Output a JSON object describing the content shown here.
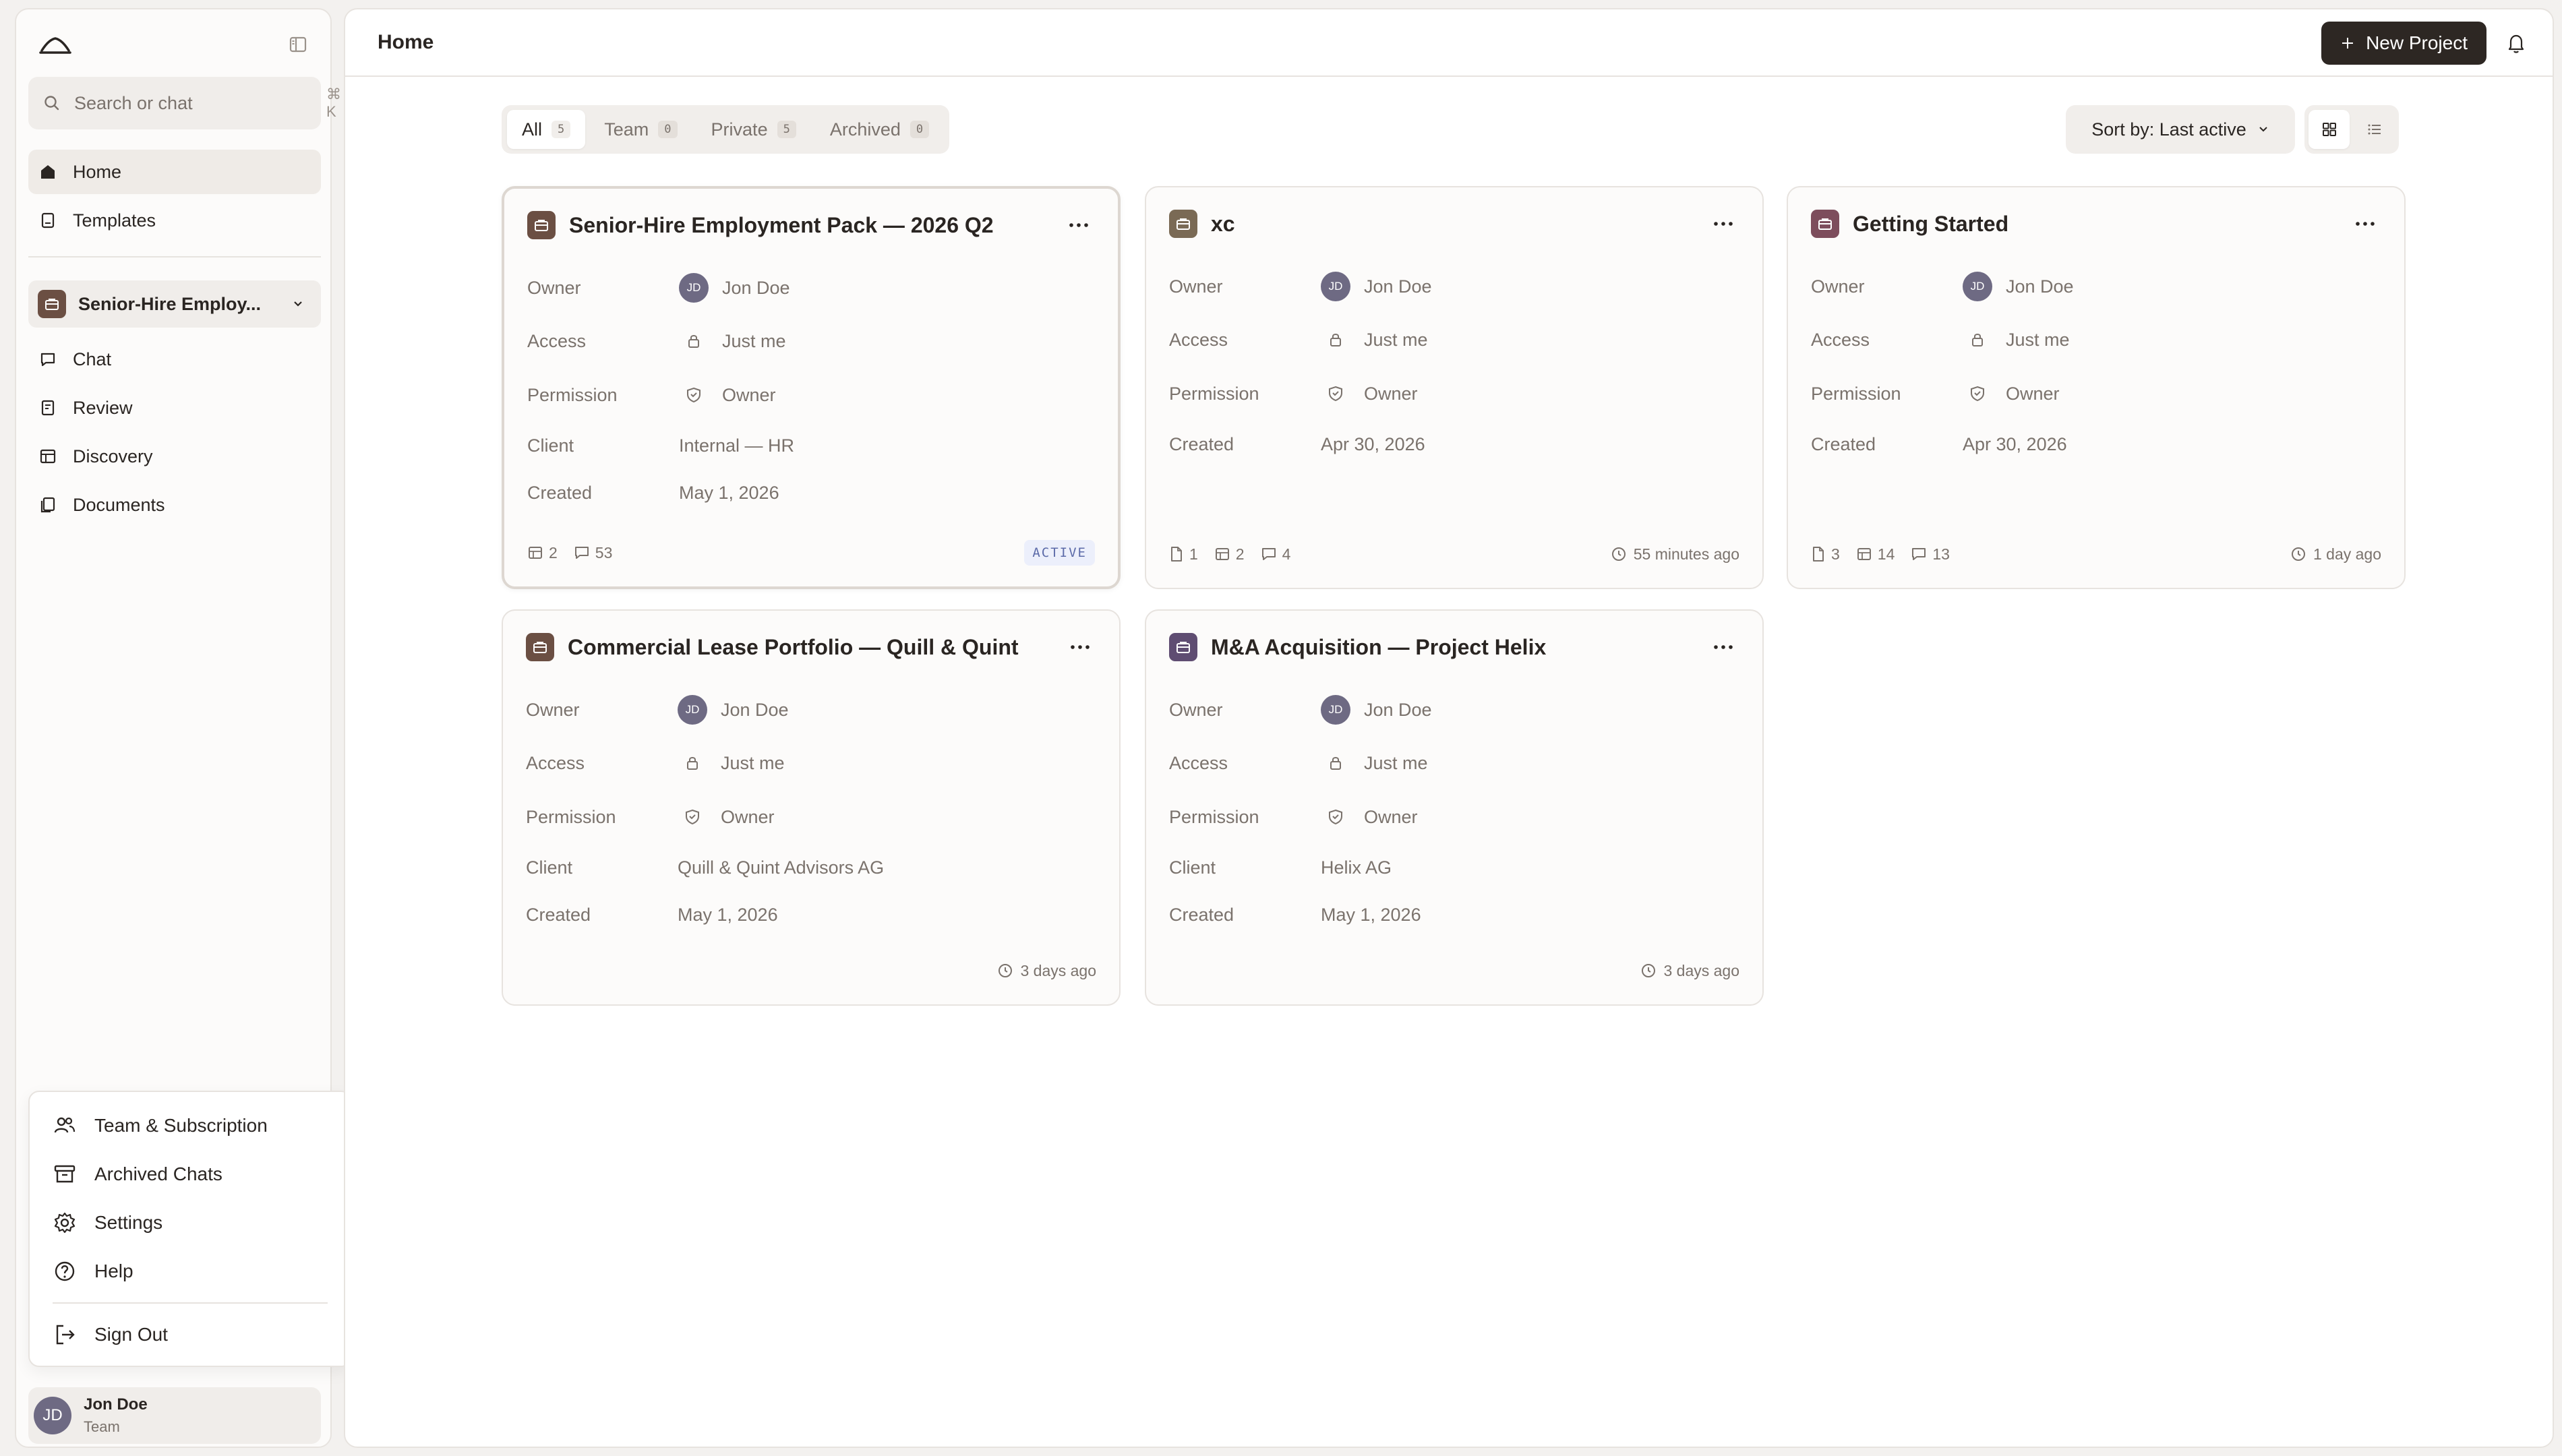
{
  "sidebar": {
    "search_placeholder": "Search or chat",
    "search_shortcut": "⌘ K",
    "nav": [
      {
        "label": "Home"
      },
      {
        "label": "Templates"
      }
    ],
    "project_selector": "Senior-Hire Employ...",
    "project_nav": [
      {
        "label": "Chat"
      },
      {
        "label": "Review"
      },
      {
        "label": "Discovery"
      },
      {
        "label": "Documents"
      }
    ],
    "menu": [
      {
        "label": "Team & Subscription"
      },
      {
        "label": "Archived Chats"
      },
      {
        "label": "Settings"
      },
      {
        "label": "Help"
      },
      {
        "label": "Sign Out"
      }
    ],
    "user": {
      "initials": "JD",
      "name": "Jon Doe",
      "role": "Team"
    }
  },
  "header": {
    "title": "Home",
    "new_project_label": "New Project"
  },
  "filters": {
    "tabs": [
      {
        "label": "All",
        "count": "5"
      },
      {
        "label": "Team",
        "count": "0"
      },
      {
        "label": "Private",
        "count": "5"
      },
      {
        "label": "Archived",
        "count": "0"
      }
    ],
    "sort_label": "Sort by: Last active"
  },
  "field_labels": {
    "owner": "Owner",
    "access": "Access",
    "permission": "Permission",
    "client": "Client",
    "created": "Created"
  },
  "colors": {
    "brand_dark": "#2d2723",
    "project_brown": "#6b4f43",
    "project_olive": "#7a6a55",
    "project_rose": "#7d4d5c",
    "project_purple": "#5f4d72",
    "avatar": "#6e6a83",
    "active_badge": "#5b6aa8"
  },
  "projects": [
    {
      "title": "Senior-Hire Employment Pack — 2026 Q2",
      "owner_initials": "JD",
      "owner": "Jon Doe",
      "access": "Just me",
      "permission": "Owner",
      "client": "Internal — HR",
      "created": "May 1, 2026",
      "stats": {
        "tables": "2",
        "chats": "53"
      },
      "badge": "ACTIVE"
    },
    {
      "title": "xc",
      "owner_initials": "JD",
      "owner": "Jon Doe",
      "access": "Just me",
      "permission": "Owner",
      "created": "Apr 30, 2026",
      "stats": {
        "docs": "1",
        "tables": "2",
        "chats": "4"
      },
      "last_active": "55 minutes ago"
    },
    {
      "title": "Getting Started",
      "owner_initials": "JD",
      "owner": "Jon Doe",
      "access": "Just me",
      "permission": "Owner",
      "created": "Apr 30, 2026",
      "stats": {
        "docs": "3",
        "tables": "14",
        "chats": "13"
      },
      "last_active": "1 day ago"
    },
    {
      "title": "Commercial Lease Portfolio — Quill & Quint",
      "owner_initials": "JD",
      "owner": "Jon Doe",
      "access": "Just me",
      "permission": "Owner",
      "client": "Quill & Quint Advisors AG",
      "created": "May 1, 2026",
      "last_active": "3 days ago"
    },
    {
      "title": "M&A Acquisition — Project Helix",
      "owner_initials": "JD",
      "owner": "Jon Doe",
      "access": "Just me",
      "permission": "Owner",
      "client": "Helix AG",
      "created": "May 1, 2026",
      "last_active": "3 days ago"
    }
  ]
}
